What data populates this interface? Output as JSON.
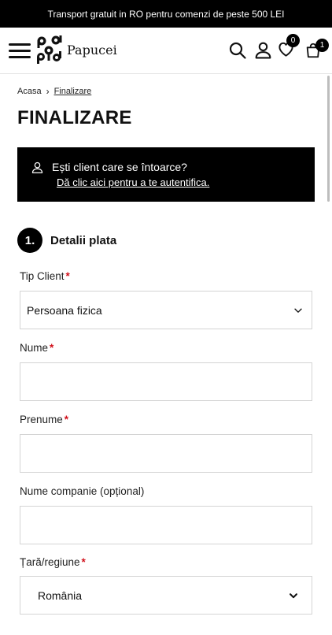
{
  "promo": {
    "text": "Transport gratuit in RO pentru comenzi de peste 500 LEI"
  },
  "header": {
    "logo_text": "Papucei",
    "wishlist_count": "0",
    "cart_count": "1"
  },
  "breadcrumb": {
    "home": "Acasa",
    "separator": "›",
    "current": "Finalizare"
  },
  "page_title": "FINALIZARE",
  "login_notice": {
    "question": "Ești client care se întoarce?",
    "link": "Dă clic aici pentru a te autentifica."
  },
  "step": {
    "number": "1.",
    "title": "Detalii plata"
  },
  "form": {
    "required_mark": "*",
    "client_type": {
      "label": "Tip Client",
      "value": "Persoana fizica"
    },
    "last_name": {
      "label": "Nume",
      "value": ""
    },
    "first_name": {
      "label": "Prenume",
      "value": ""
    },
    "company": {
      "label": "Nume companie (opțional)",
      "value": ""
    },
    "country": {
      "label": "Țară/regiune",
      "value": "România"
    }
  },
  "colors": {
    "primary": "#000000",
    "required": "#d1111c",
    "border": "#d4d4d4"
  },
  "icons": [
    "hamburger-icon",
    "search-icon",
    "user-icon",
    "heart-icon",
    "bag-icon",
    "chevron-down-icon"
  ]
}
